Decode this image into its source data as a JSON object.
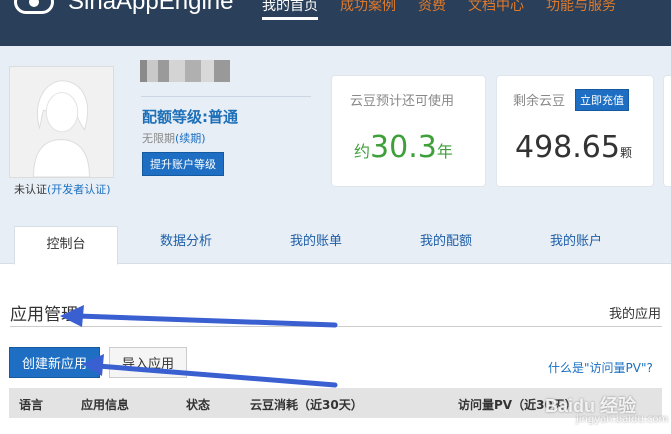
{
  "header": {
    "logo_text": "SinaAppEngine",
    "nav": [
      "我的首页",
      "成功案例",
      "资费",
      "文档中心",
      "功能与服务"
    ]
  },
  "profile": {
    "verify_status": "未认证",
    "verify_link": "(开发者认证)",
    "quota_level": "配额等级:普通",
    "expire_text": "无限期",
    "renew_link": "(续期)",
    "upgrade_button": "提升账户等级"
  },
  "cards": {
    "remaining_time_title": "云豆预计还可使用",
    "remaining_prefix": "约",
    "remaining_value": "30.3",
    "remaining_unit": "年",
    "balance_title": "剩余云豆",
    "recharge_button": "立即充值",
    "balance_value": "498.65",
    "balance_unit": "颗"
  },
  "tabs": [
    "控制台",
    "数据分析",
    "我的账单",
    "我的配额",
    "我的账户"
  ],
  "apps": {
    "section_title": "应用管理",
    "my_apps": "我的应用",
    "create_button": "创建新应用",
    "import_button": "导入应用",
    "pv_link": "什么是\"访问量PV\"?",
    "columns": [
      "语言",
      "应用信息",
      "状态",
      "云豆消耗（近30天）",
      "访问量PV（近30天）"
    ]
  },
  "watermark": {
    "text": "Baidu 经验",
    "sub": "jingyan.baidu.com"
  },
  "colors": {
    "topbar": "#2a3f59",
    "accent_blue": "#1e6fc3",
    "green": "#3fa03a",
    "band": "#e8eef5"
  }
}
